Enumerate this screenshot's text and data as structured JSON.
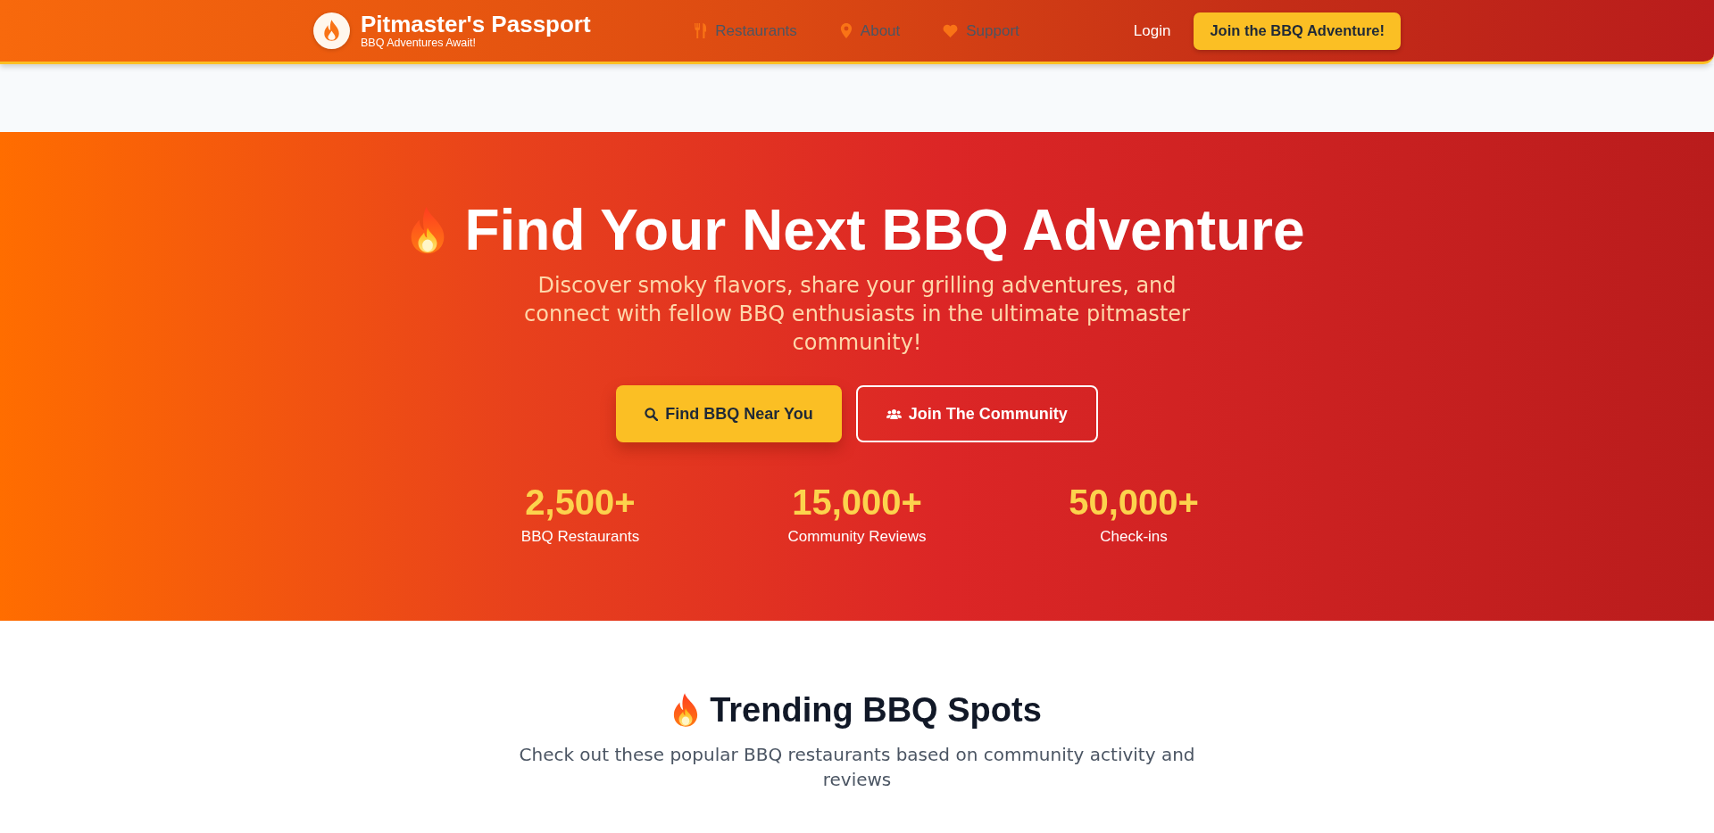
{
  "header": {
    "brand": {
      "title": "Pitmaster's Passport",
      "tagline": "BBQ Adventures Await!"
    },
    "nav": [
      {
        "label": "Restaurants"
      },
      {
        "label": "About"
      },
      {
        "label": "Support"
      }
    ],
    "login": "Login",
    "cta": "Join the BBQ Adventure!"
  },
  "hero": {
    "title": "Find Your Next BBQ Adventure",
    "subtitle": "Discover smoky flavors, share your grilling adventures, and connect with fellow BBQ enthusiasts in the ultimate pitmaster community!",
    "buttons": [
      {
        "label": "Find BBQ Near You",
        "kind": "primary"
      },
      {
        "label": "Join The Community",
        "kind": "outline"
      }
    ],
    "stats": [
      {
        "value": "2,500+",
        "label": "BBQ Restaurants"
      },
      {
        "value": "15,000+",
        "label": "Community Reviews"
      },
      {
        "value": "50,000+",
        "label": "Check-ins"
      }
    ]
  },
  "trending": {
    "title": "Trending BBQ Spots",
    "subtitle": "Check out these popular BBQ restaurants based on community activity and reviews"
  }
}
